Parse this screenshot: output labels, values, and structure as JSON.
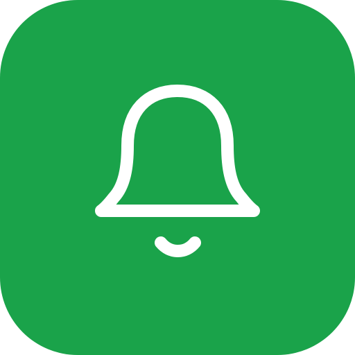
{
  "icon": {
    "name": "bell-icon",
    "background_color": "#1aa34a",
    "glyph_color": "#ffffff"
  }
}
